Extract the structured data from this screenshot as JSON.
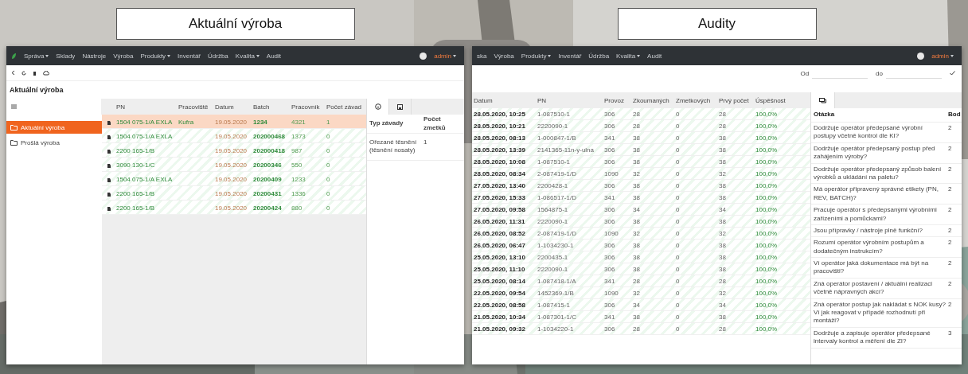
{
  "production_panel": {
    "title": "Aktuální výroba",
    "nav": {
      "items": [
        {
          "label": "Správa",
          "dropdown": true
        },
        {
          "label": "Sklady",
          "dropdown": false
        },
        {
          "label": "Nástroje",
          "dropdown": false
        },
        {
          "label": "Výroba",
          "dropdown": false
        },
        {
          "label": "Produkty",
          "dropdown": true
        },
        {
          "label": "Inventář",
          "dropdown": false
        },
        {
          "label": "Údržba",
          "dropdown": false
        },
        {
          "label": "Kvalita",
          "dropdown": true
        },
        {
          "label": "Audit",
          "dropdown": false
        }
      ],
      "user": "admin"
    },
    "page_title": "Aktuální výroba",
    "tree": [
      {
        "label": "Aktuální výroba",
        "selected": true
      },
      {
        "label": "Prošlá výroba",
        "selected": false
      }
    ],
    "table": {
      "columns": [
        "PN",
        "Pracoviště",
        "Datum",
        "Batch",
        "Pracovník",
        "Počet závad"
      ],
      "rows": [
        {
          "cells": [
            "1504 075-1/A EXLA",
            "Kufra",
            "19.05.2020",
            "1234",
            "4321",
            "1"
          ],
          "selected": true
        },
        {
          "cells": [
            "1504 075-1/A EXLA",
            "",
            "19.05.2020",
            "202000468",
            "1373",
            "0"
          ],
          "selected": false
        },
        {
          "cells": [
            "2200 165-1/B",
            "",
            "19.05.2020",
            "202000418",
            "987",
            "0"
          ],
          "selected": false
        },
        {
          "cells": [
            "3090 130-1/C",
            "",
            "19.05.2020",
            "20200346",
            "550",
            "0"
          ],
          "selected": false
        },
        {
          "cells": [
            "1504 075-1/A EXLA",
            "",
            "19.05.2020",
            "20200409",
            "1233",
            "0"
          ],
          "selected": false
        },
        {
          "cells": [
            "2200 165-1/B",
            "",
            "19.05.2020",
            "20200431",
            "1336",
            "0"
          ],
          "selected": false
        },
        {
          "cells": [
            "2200 165-1/B",
            "",
            "19.05.2020",
            "20200424",
            "880",
            "0"
          ],
          "selected": false
        }
      ]
    },
    "detail": {
      "tabs": [
        {
          "selected": true
        },
        {
          "selected": false
        }
      ],
      "columns": [
        "Typ závady",
        "Počet zmetků"
      ],
      "rows": [
        [
          "Ořezané těsnění (těsnění nosaty)",
          "1"
        ]
      ]
    }
  },
  "audit_panel": {
    "title": "Audity",
    "nav": {
      "items": [
        {
          "label": "ska",
          "dropdown": false
        },
        {
          "label": "Výroba",
          "dropdown": false
        },
        {
          "label": "Produkty",
          "dropdown": true
        },
        {
          "label": "Inventář",
          "dropdown": false
        },
        {
          "label": "Údržba",
          "dropdown": false
        },
        {
          "label": "Kvalita",
          "dropdown": true
        },
        {
          "label": "Audit",
          "dropdown": false
        }
      ],
      "user": "admin"
    },
    "filter": {
      "from_label": "Od",
      "to_label": "do"
    },
    "table": {
      "columns": [
        "Datum",
        "PN",
        "Provoz",
        "Zkoumaných",
        "Zmetkových",
        "Prvý počet",
        "Úspěšnost"
      ],
      "rows": [
        [
          "28.05.2020, 10:25",
          "1-087510-1",
          "306",
          "28",
          "0",
          "28",
          "100,0%"
        ],
        [
          "28.05.2020, 10:21",
          "2220090-1",
          "306",
          "28",
          "0",
          "28",
          "100,0%"
        ],
        [
          "28.05.2020, 08:13",
          "1-000847-1/B",
          "341",
          "38",
          "0",
          "38",
          "100,0%"
        ],
        [
          "28.05.2020, 13:39",
          "2141365-11n-y-ulna",
          "306",
          "38",
          "0",
          "38",
          "100,0%"
        ],
        [
          "28.05.2020, 10:08",
          "1-087510-1",
          "306",
          "38",
          "0",
          "38",
          "100,0%"
        ],
        [
          "28.05.2020, 08:34",
          "2-087419-1/D",
          "1090",
          "32",
          "0",
          "32",
          "100,0%"
        ],
        [
          "27.05.2020, 13:40",
          "2200428-1",
          "306",
          "38",
          "0",
          "38",
          "100,0%"
        ],
        [
          "27.05.2020, 15:33",
          "1-086517-1/D",
          "341",
          "38",
          "0",
          "38",
          "100,0%"
        ],
        [
          "27.05.2020, 09:58",
          "1564875-1",
          "306",
          "34",
          "0",
          "34",
          "100,0%"
        ],
        [
          "26.05.2020, 11:31",
          "2220090-1",
          "306",
          "38",
          "0",
          "38",
          "100,0%"
        ],
        [
          "26.05.2020, 08:52",
          "2-087419-1/D",
          "1090",
          "32",
          "0",
          "32",
          "100,0%"
        ],
        [
          "26.05.2020, 06:47",
          "1-1034230-1",
          "306",
          "38",
          "0",
          "38",
          "100,0%"
        ],
        [
          "25.05.2020, 13:10",
          "2200435-1",
          "306",
          "38",
          "0",
          "38",
          "100,0%"
        ],
        [
          "25.05.2020, 11:10",
          "2220090-1",
          "306",
          "38",
          "0",
          "38",
          "100,0%"
        ],
        [
          "25.05.2020, 08:14",
          "1-087418-1/A",
          "341",
          "28",
          "0",
          "28",
          "100,0%"
        ],
        [
          "22.05.2020, 09:54",
          "1452369-1/B",
          "1090",
          "32",
          "0",
          "32",
          "100,0%"
        ],
        [
          "22.05.2020, 08:58",
          "1-087415-1",
          "306",
          "34",
          "0",
          "34",
          "100,0%"
        ],
        [
          "21.05.2020, 10:34",
          "1-087301-1/C",
          "341",
          "38",
          "0",
          "38",
          "100,0%"
        ],
        [
          "21.05.2020, 09:32",
          "1-1034220-1",
          "306",
          "28",
          "0",
          "28",
          "100,0%"
        ]
      ]
    },
    "questions": {
      "tabs": [
        {
          "selected": true
        }
      ],
      "columns": [
        "Otázka",
        "Bod"
      ],
      "rows": [
        [
          "Dodržuje operátor předepsané výrobní postupy včetně kontrol dle KI?",
          "2"
        ],
        [
          "Dodržuje operátor předepsaný postup před zahájením výroby?",
          "2"
        ],
        [
          "Dodržuje operátor předepsaný způsob balení výrobků a ukládání na paletu?",
          "2"
        ],
        [
          "Má operátor připravený správné etikety (PN, REV, BATCH)?",
          "2"
        ],
        [
          "Pracuje operátor s předepsanými výrobními zařízeními a pomůckami?",
          "2"
        ],
        [
          "Jsou přípravky / nástroje plně funkční?",
          "2"
        ],
        [
          "Rozumí operátor výrobním postupům a dodatečným instrukcím?",
          "2"
        ],
        [
          "Ví operátor jaká dokumentace má být na pracovišti?",
          "2"
        ],
        [
          "Zná operátor postavení / aktuální realizaci včetně nápravných akcí?",
          "2"
        ],
        [
          "Zná operátor postup jak nakládat s NOK kusy? Ví jak reagovat v případě rozhodnutí při montáži?",
          "2"
        ],
        [
          "Dodržuje a zapisuje operátor předepsané intervaly kontrol a měření dle ZI?",
          "3"
        ]
      ]
    }
  }
}
